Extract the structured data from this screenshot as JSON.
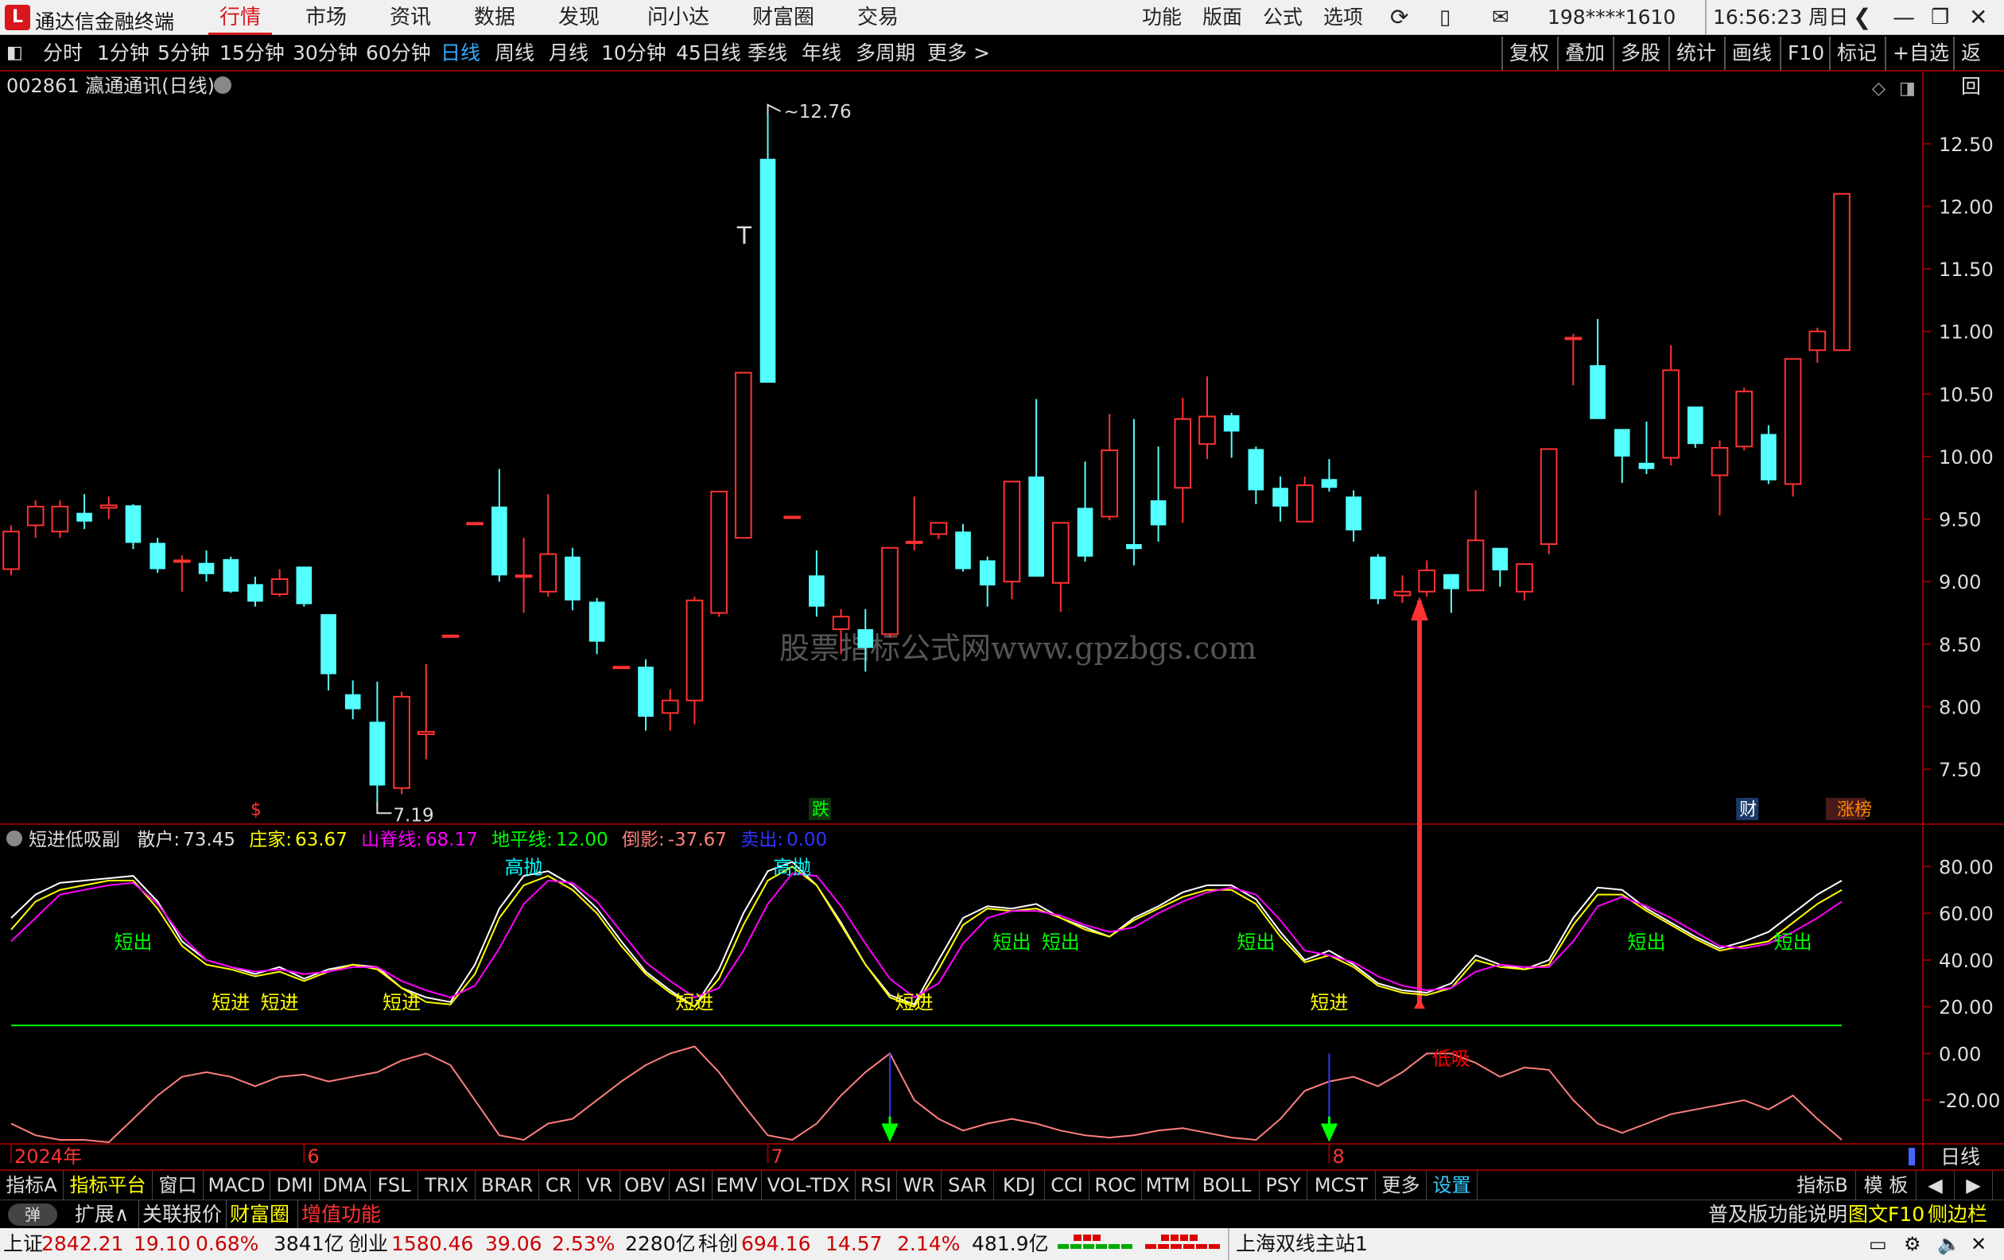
{
  "app": {
    "logo": "L",
    "title": "通达信金融终端",
    "menus": [
      "行情",
      "市场",
      "资讯",
      "数据",
      "发现",
      "问小达",
      "财富圈",
      "交易"
    ],
    "active_menu": "行情",
    "right_menus": [
      "功能",
      "版面",
      "公式",
      "选项"
    ],
    "account": "198****1610",
    "time": "16:56:23",
    "weekday": "周日"
  },
  "periods": [
    "分时",
    "1分钟",
    "5分钟",
    "15分钟",
    "30分钟",
    "60分钟",
    "日线",
    "周线",
    "月线",
    "10分钟",
    "45日线",
    "季线",
    "年线",
    "多周期",
    "更多 >"
  ],
  "active_period": "日线",
  "right_tools": [
    "复权",
    "叠加",
    "多股",
    "统计",
    "画线",
    "F10",
    "标记",
    "+自选",
    "返回"
  ],
  "stock": {
    "title": "002861 瀛通通讯(日线)"
  },
  "watermark": "股票指标公式网www.gpzbgs.com",
  "chart_data": [
    {
      "type": "candlestick",
      "name": "price",
      "ylim": [
        7.1,
        12.95
      ],
      "yticks": [
        7.5,
        8.0,
        8.5,
        9.0,
        9.5,
        10.0,
        10.5,
        11.0,
        11.5,
        12.0,
        12.5
      ],
      "ytick_labels": [
        "7.50",
        "8.00",
        "8.50",
        "9.00",
        "9.50",
        "10.00",
        "10.50",
        "11.00",
        "11.50",
        "12.00",
        "12.50"
      ],
      "annot_high": "12.76",
      "annot_low": "7.19",
      "candles": [
        [
          9.1,
          9.4,
          9.45,
          9.05
        ],
        [
          9.45,
          9.6,
          9.65,
          9.35
        ],
        [
          9.4,
          9.6,
          9.65,
          9.35
        ],
        [
          9.55,
          9.48,
          9.7,
          9.42
        ],
        [
          9.59,
          9.61,
          9.68,
          9.5
        ],
        [
          9.61,
          9.31,
          9.62,
          9.26
        ],
        [
          9.31,
          9.1,
          9.35,
          9.07
        ],
        [
          9.17,
          9.17,
          9.21,
          8.92
        ],
        [
          9.15,
          9.06,
          9.25,
          9.0
        ],
        [
          9.18,
          8.92,
          9.2,
          8.91
        ],
        [
          8.98,
          8.84,
          9.04,
          8.8
        ],
        [
          8.9,
          9.02,
          9.1,
          8.88
        ],
        [
          9.12,
          8.82,
          9.12,
          8.8
        ],
        [
          8.74,
          8.26,
          8.74,
          8.13
        ],
        [
          8.1,
          7.98,
          8.21,
          7.9
        ],
        [
          7.88,
          7.37,
          8.2,
          7.2
        ],
        [
          7.35,
          8.08,
          8.12,
          7.3
        ],
        [
          7.78,
          7.8,
          8.34,
          7.58
        ],
        [
          8.57,
          8.57,
          8.57,
          8.57
        ],
        [
          9.47,
          9.47,
          9.47,
          9.47
        ],
        [
          9.6,
          9.05,
          9.9,
          9.0
        ],
        [
          9.05,
          9.05,
          9.35,
          8.75
        ],
        [
          8.92,
          9.22,
          9.7,
          8.88
        ],
        [
          9.2,
          8.85,
          9.27,
          8.77
        ],
        [
          8.84,
          8.52,
          8.87,
          8.42
        ],
        [
          8.32,
          8.32,
          8.32,
          8.32
        ],
        [
          8.32,
          7.92,
          8.38,
          7.81
        ],
        [
          7.95,
          8.05,
          8.14,
          7.81
        ],
        [
          8.05,
          8.85,
          8.88,
          7.86
        ],
        [
          8.75,
          9.72,
          9.72,
          8.72
        ],
        [
          9.35,
          10.67,
          10.67,
          9.35
        ],
        [
          12.38,
          10.59,
          12.76,
          10.59
        ],
        [
          9.52,
          9.52,
          9.52,
          9.52
        ],
        [
          9.05,
          8.8,
          9.25,
          8.72
        ],
        [
          8.62,
          8.72,
          8.78,
          8.42
        ],
        [
          8.62,
          8.47,
          8.78,
          8.28
        ],
        [
          8.58,
          9.27,
          9.27,
          8.55
        ],
        [
          9.32,
          9.32,
          9.68,
          9.25
        ],
        [
          9.38,
          9.47,
          9.47,
          9.34
        ],
        [
          9.4,
          9.1,
          9.46,
          9.08
        ],
        [
          9.17,
          8.97,
          9.2,
          8.8
        ],
        [
          9.0,
          9.8,
          9.8,
          8.86
        ],
        [
          9.84,
          9.04,
          10.46,
          9.04
        ],
        [
          8.99,
          9.47,
          9.47,
          8.76
        ],
        [
          9.59,
          9.2,
          9.96,
          9.16
        ],
        [
          9.52,
          10.05,
          10.34,
          9.49
        ],
        [
          9.3,
          9.26,
          10.3,
          9.13
        ],
        [
          9.65,
          9.45,
          10.08,
          9.32
        ],
        [
          9.75,
          10.3,
          10.47,
          9.47
        ],
        [
          10.1,
          10.32,
          10.64,
          9.98
        ],
        [
          10.33,
          10.2,
          10.35,
          9.99
        ],
        [
          10.06,
          9.73,
          10.08,
          9.62
        ],
        [
          9.75,
          9.6,
          9.84,
          9.48
        ],
        [
          9.48,
          9.77,
          9.84,
          9.48
        ],
        [
          9.82,
          9.75,
          9.98,
          9.72
        ],
        [
          9.68,
          9.41,
          9.73,
          9.32
        ],
        [
          9.2,
          8.86,
          9.22,
          8.82
        ],
        [
          8.89,
          8.92,
          9.05,
          8.83
        ],
        [
          8.92,
          9.09,
          9.17,
          8.88
        ],
        [
          9.06,
          8.94,
          9.06,
          8.75
        ],
        [
          8.93,
          9.33,
          9.73,
          8.93
        ],
        [
          9.27,
          9.09,
          9.27,
          8.96
        ],
        [
          8.92,
          9.14,
          9.14,
          8.85
        ],
        [
          9.3,
          10.06,
          10.06,
          9.22
        ],
        [
          10.95,
          10.95,
          10.98,
          10.57
        ],
        [
          10.73,
          10.3,
          11.1,
          10.3
        ],
        [
          10.22,
          10.0,
          10.22,
          9.79
        ],
        [
          9.95,
          9.9,
          10.28,
          9.86
        ],
        [
          9.99,
          10.69,
          10.89,
          9.93
        ],
        [
          10.4,
          10.1,
          10.4,
          10.07
        ],
        [
          9.85,
          10.07,
          10.13,
          9.53
        ],
        [
          10.08,
          10.52,
          10.55,
          10.05
        ],
        [
          10.18,
          9.81,
          10.25,
          9.78
        ],
        [
          9.78,
          10.78,
          10.78,
          9.68
        ],
        [
          10.85,
          11.0,
          11.03,
          10.75
        ],
        [
          10.85,
          12.1,
          12.1,
          10.85
        ]
      ]
    },
    {
      "type": "line",
      "name": "短进低吸副",
      "ylim": [
        -37.67,
        90
      ],
      "yticks": [
        -20,
        0,
        20,
        40,
        60,
        80
      ],
      "ytick_labels": [
        "-20.00",
        "0.00",
        "20.00",
        "40.00",
        "60.00",
        "80.00"
      ],
      "indicator_name": "短进低吸副",
      "values": {
        "散户": "73.45",
        "庄家": "63.67",
        "山脊线": "68.17",
        "地平线": "12.00",
        "倒影": "-37.67",
        "卖出": "0.00"
      },
      "series": [
        {
          "name": "散户",
          "values": [
            58,
            68,
            73,
            74,
            75,
            76,
            65,
            48,
            40,
            37,
            34,
            37,
            32,
            36,
            38,
            37,
            28,
            24,
            22,
            38,
            62,
            76,
            78,
            72,
            62,
            48,
            35,
            27,
            20,
            36,
            60,
            78,
            82,
            72,
            56,
            38,
            25,
            21,
            40,
            58,
            63,
            62,
            64,
            58,
            54,
            50,
            58,
            63,
            69,
            72,
            72,
            66,
            52,
            40,
            44,
            38,
            30,
            27,
            26,
            30,
            42,
            38,
            36,
            40,
            58,
            71,
            70,
            62,
            56,
            50,
            45,
            48,
            52,
            60,
            68,
            74
          ]
        },
        {
          "name": "庄家",
          "values": [
            53,
            65,
            70,
            72,
            74,
            74,
            62,
            46,
            38,
            36,
            33,
            35,
            31,
            35,
            38,
            36,
            28,
            22,
            21,
            34,
            58,
            72,
            76,
            70,
            60,
            46,
            34,
            26,
            20,
            32,
            55,
            74,
            80,
            72,
            55,
            38,
            24,
            20,
            36,
            55,
            62,
            61,
            62,
            58,
            53,
            50,
            57,
            62,
            67,
            70,
            70,
            64,
            50,
            39,
            42,
            37,
            29,
            26,
            25,
            28,
            40,
            37,
            36,
            38,
            55,
            68,
            68,
            61,
            55,
            49,
            44,
            46,
            48,
            56,
            64,
            70
          ]
        },
        {
          "name": "山脊线",
          "values": [
            48,
            58,
            68,
            70,
            72,
            73,
            64,
            50,
            40,
            37,
            35,
            36,
            34,
            35,
            37,
            37,
            31,
            27,
            24,
            29,
            45,
            64,
            74,
            73,
            65,
            52,
            39,
            31,
            24,
            28,
            44,
            64,
            77,
            76,
            63,
            47,
            32,
            24,
            30,
            47,
            58,
            61,
            61,
            59,
            55,
            52,
            54,
            60,
            65,
            69,
            71,
            68,
            57,
            44,
            42,
            39,
            33,
            29,
            27,
            28,
            35,
            38,
            37,
            37,
            48,
            63,
            67,
            63,
            58,
            52,
            46,
            45,
            47,
            52,
            58,
            65
          ]
        },
        {
          "name": "地平线",
          "values": [
            12
          ]
        },
        {
          "name": "倒影",
          "values": [
            -30,
            -35,
            -37,
            -37,
            -38,
            -28,
            -18,
            -10,
            -8,
            -10,
            -14,
            -10,
            -9,
            -12,
            -10,
            -8,
            -3,
            0,
            -5,
            -20,
            -35,
            -37,
            -30,
            -28,
            -20,
            -12,
            -5,
            0,
            3,
            -8,
            -22,
            -35,
            -37,
            -30,
            -18,
            -8,
            0,
            -20,
            -28,
            -33,
            -30,
            -28,
            -30,
            -33,
            -35,
            -36,
            -35,
            -33,
            -32,
            -34,
            -36,
            -37,
            -28,
            -16,
            -12,
            -10,
            -14,
            -8,
            0,
            0,
            -4,
            -10,
            -6,
            -7,
            -20,
            -30,
            -34,
            -30,
            -26,
            -24,
            -22,
            -20,
            -24,
            -18,
            -28,
            -37
          ]
        }
      ],
      "labels": [
        {
          "text": "短出",
          "i": 5,
          "v": 48,
          "c": "#0f0"
        },
        {
          "text": "短进",
          "i": 9,
          "v": 22,
          "c": "#ff0"
        },
        {
          "text": "短进",
          "i": 11,
          "v": 22,
          "c": "#ff0"
        },
        {
          "text": "短进",
          "i": 16,
          "v": 22,
          "c": "#ff0"
        },
        {
          "text": "高抛",
          "i": 21,
          "v": 80,
          "c": "#0ff"
        },
        {
          "text": "短进",
          "i": 28,
          "v": 22,
          "c": "#ff0"
        },
        {
          "text": "高抛",
          "i": 32,
          "v": 80,
          "c": "#0ff"
        },
        {
          "text": "短进",
          "i": 37,
          "v": 22,
          "c": "#ff0"
        },
        {
          "text": "短出",
          "i": 41,
          "v": 48,
          "c": "#0f0"
        },
        {
          "text": "短出",
          "i": 43,
          "v": 48,
          "c": "#0f0"
        },
        {
          "text": "短出",
          "i": 51,
          "v": 48,
          "c": "#0f0"
        },
        {
          "text": "短进",
          "i": 54,
          "v": 22,
          "c": "#ff0"
        },
        {
          "text": "低吸",
          "i": 59,
          "v": -2,
          "c": "#f00"
        },
        {
          "text": "短出",
          "i": 67,
          "v": 48,
          "c": "#0f0"
        },
        {
          "text": "短出",
          "i": 73,
          "v": 48,
          "c": "#0f0"
        }
      ],
      "sell_arrows": [
        36,
        54
      ]
    },
    {
      "type": "axis",
      "name": "date_axis",
      "labels": [
        {
          "text": "2024年",
          "i": 0
        },
        {
          "text": "6",
          "i": 12
        },
        {
          "text": "7",
          "i": 31
        },
        {
          "text": "8",
          "i": 54
        }
      ],
      "period_label": "日线"
    }
  ],
  "markers": [
    {
      "text": "$",
      "i": 10,
      "c": "#f33"
    },
    {
      "text": "跌",
      "i": 33,
      "c": "#0f0"
    },
    {
      "text": "财",
      "i": 71,
      "c": "#fff"
    },
    {
      "text": "涨榜",
      "i": 75,
      "c": "#f80"
    }
  ],
  "indicators_a": [
    "指标A",
    "指标平台",
    "窗口",
    "MACD",
    "DMI",
    "DMA",
    "FSL",
    "TRIX",
    "BRAR",
    "CR",
    "VR",
    "OBV",
    "ASI",
    "EMV",
    "VOL-TDX",
    "RSI",
    "WR",
    "SAR",
    "KDJ",
    "CCI",
    "ROC",
    "MTM",
    "BOLL",
    "PSY",
    "MCST",
    "更多",
    "设置"
  ],
  "indicators_b": [
    "指标B",
    "模 板",
    "◀",
    "▶"
  ],
  "zoom": [
    "+",
    "−"
  ],
  "ext": {
    "toggle": "弹",
    "expand": "扩展∧",
    "related": "关联报价",
    "wealth": "财富圈",
    "value_add": "增值功能",
    "promo": "普及版功能说明",
    "f10": "图文F10",
    "sidebar": "侧边栏 «"
  },
  "status": {
    "sh_label": "上证",
    "sh_val": "2842.21",
    "sh_chg": "19.10",
    "sh_pct": "0.68%",
    "sh_amt": "3841亿",
    "cy_label": "创业",
    "cy_val": "1580.46",
    "cy_chg": "39.06",
    "cy_pct": "2.53%",
    "cy_amt": "2280亿",
    "kc_label": "科创",
    "kc_val": "694.16",
    "kc_chg": "14.57",
    "kc_pct": "2.14%",
    "kc_amt": "481.9亿",
    "server": "上海双线主站1"
  },
  "colors": {
    "up": "#ff3232",
    "down": "#54ffff",
    "bg": "#000000",
    "grid_axis": "#8b0000"
  }
}
